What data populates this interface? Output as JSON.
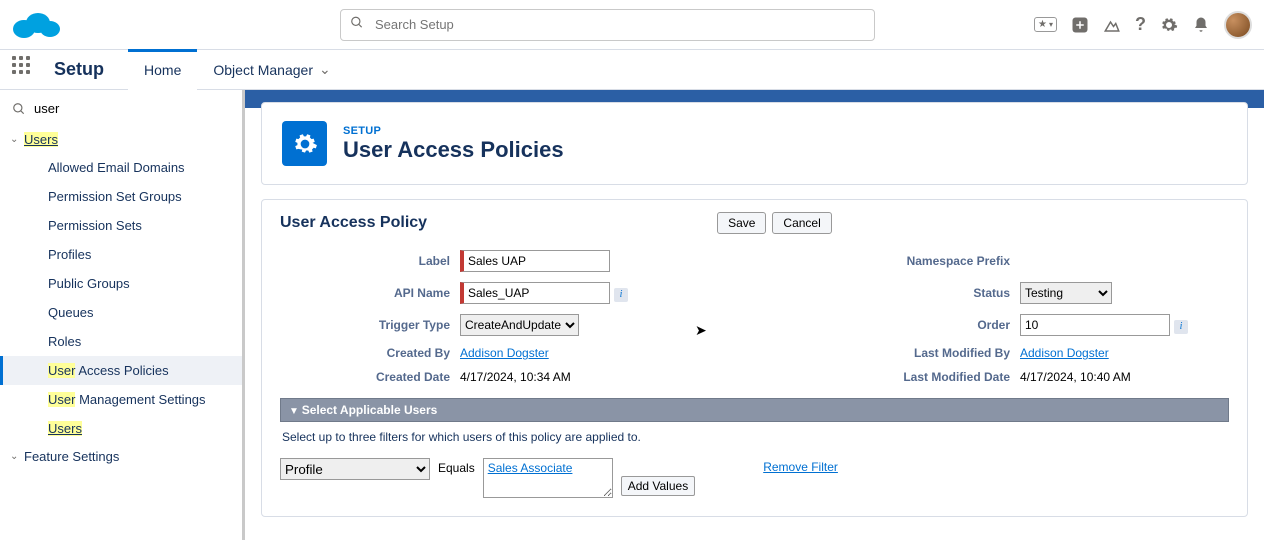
{
  "header": {
    "search_placeholder": "Search Setup"
  },
  "nav": {
    "setup": "Setup",
    "home": "Home",
    "object_manager": "Object Manager"
  },
  "sidebar": {
    "filter": "user",
    "node_users": "Users",
    "items": [
      "Allowed Email Domains",
      "Permission Set Groups",
      "Permission Sets",
      "Profiles",
      "Public Groups",
      "Queues",
      "Roles",
      "User Access Policies",
      "User Management Settings",
      "Users"
    ],
    "feature_settings": "Feature Settings"
  },
  "page": {
    "pre": "SETUP",
    "title": "User Access Policies"
  },
  "panel": {
    "title": "User Access Policy",
    "save": "Save",
    "cancel": "Cancel"
  },
  "form": {
    "label_l": "Label",
    "label_v": "Sales UAP",
    "api_l": "API Name",
    "api_v": "Sales_UAP",
    "trigger_l": "Trigger Type",
    "trigger_v": "CreateAndUpdate",
    "created_by_l": "Created By",
    "created_by_v": "Addison Dogster",
    "created_date_l": "Created Date",
    "created_date_v": "4/17/2024, 10:34 AM",
    "ns_l": "Namespace Prefix",
    "status_l": "Status",
    "status_v": "Testing",
    "order_l": "Order",
    "order_v": "10",
    "lmb_l": "Last Modified By",
    "lmb_v": "Addison Dogster",
    "lmd_l": "Last Modified Date",
    "lmd_v": "4/17/2024, 10:40 AM"
  },
  "section": {
    "title": "Select Applicable Users",
    "help": "Select up to three filters for which users of this policy are applied to.",
    "filter_field": "Profile",
    "op": "Equals",
    "filter_value": "Sales Associate",
    "remove": "Remove Filter",
    "add_values": "Add Values"
  }
}
